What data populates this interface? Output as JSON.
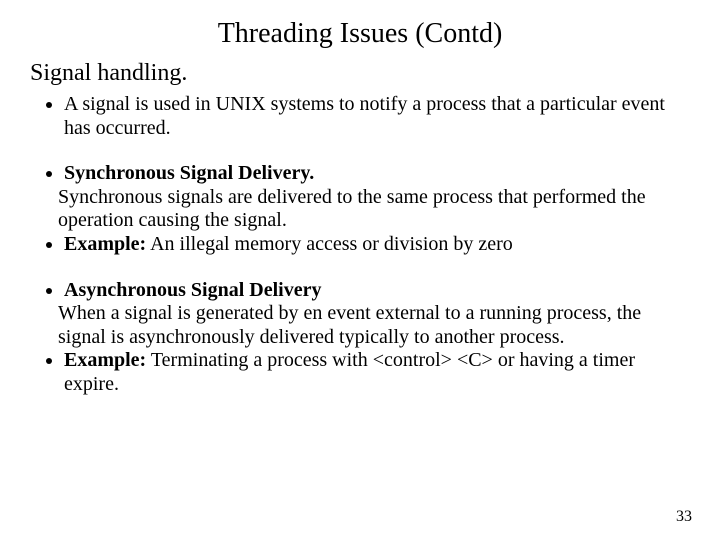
{
  "title": "Threading Issues (Contd)",
  "subhead": "Signal handling.",
  "bullets": {
    "b1": "A signal is used in UNIX systems to notify a process that a particular event has occurred.",
    "b2_head": "Synchronous Signal Delivery.",
    "b2_body": "Synchronous signals are delivered to the same process that performed the operation causing the signal.",
    "b3_label": "Example:",
    "b3_text": " An illegal memory access or division by zero",
    "b4_head": "Asynchronous Signal Delivery",
    "b4_body": "When a signal is generated by en event external to a running process, the signal is asynchronously delivered typically to another process.",
    "b5_label": "Example:",
    "b5_text": " Terminating a process with <control> <C> or having a timer expire."
  },
  "page_number": "33"
}
